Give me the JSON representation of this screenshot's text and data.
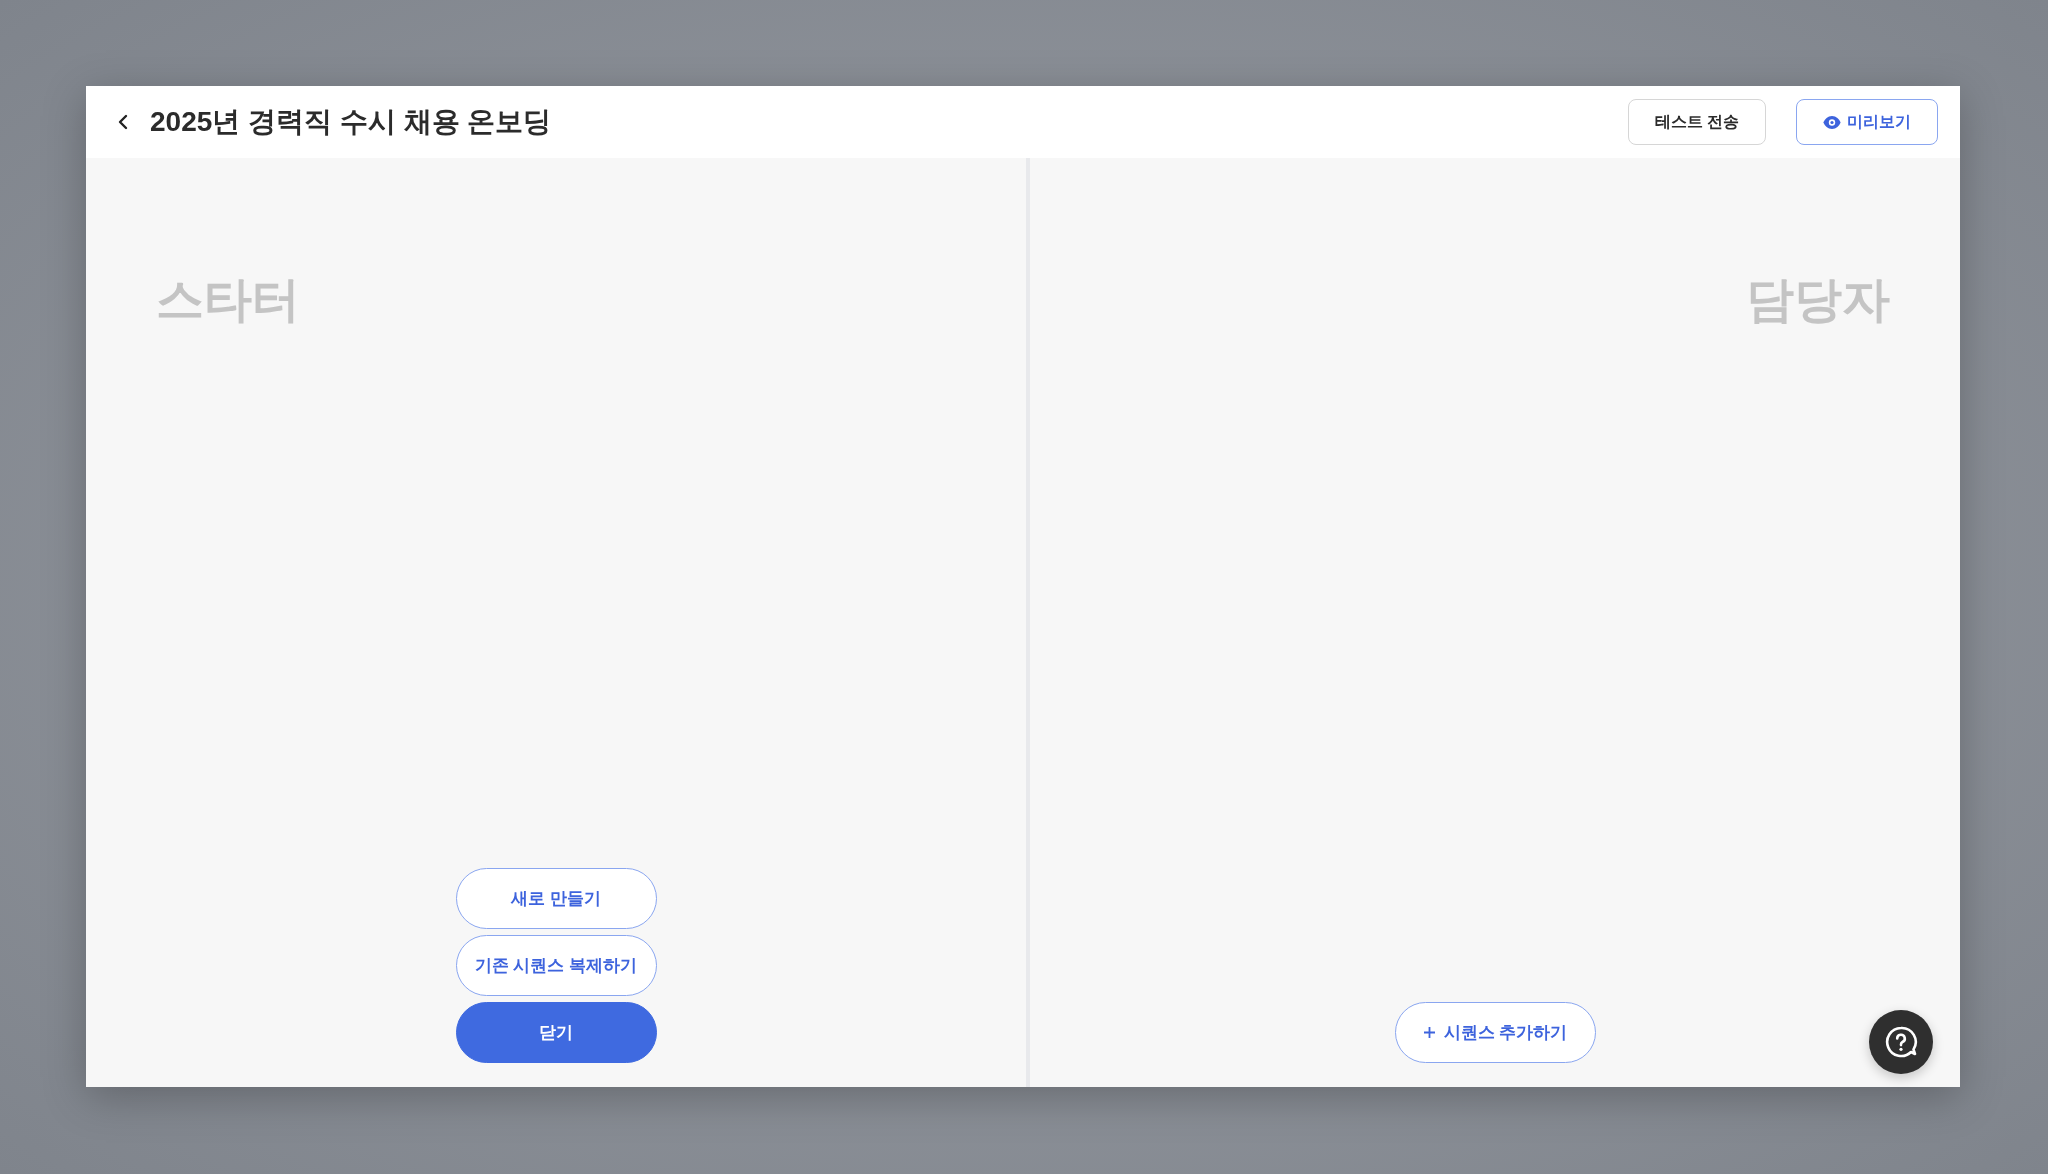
{
  "header": {
    "title": "2025년 경력직 수시 채용 온보딩",
    "actions": [
      {
        "kind": "neutral",
        "label": "테스트 전송"
      },
      {
        "kind": "accent",
        "label": "미리보기"
      }
    ]
  },
  "left_panel": {
    "heading": "스타터",
    "buttons": [
      {
        "kind": "outline",
        "label": "새로 만들기"
      },
      {
        "kind": "outline",
        "label": "기존 시퀀스 복제하기"
      },
      {
        "kind": "filled",
        "label": "닫기"
      }
    ]
  },
  "right_panel": {
    "heading": "담당자",
    "add_button": {
      "label": "시퀀스 추가하기"
    }
  }
}
